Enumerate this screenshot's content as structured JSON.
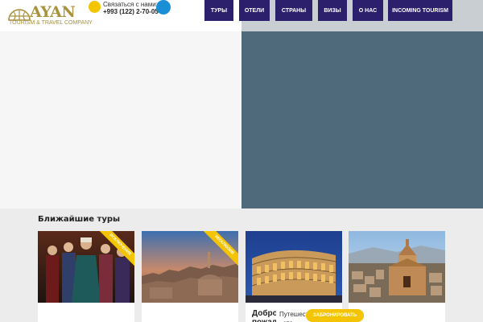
{
  "header": {
    "logo": {
      "word": "AYAN",
      "tagline": "TOURISM & TRAVEL COMPANY"
    },
    "contact": {
      "label": "Связаться с нами:",
      "phone": "+993 (122) 2-70-05"
    },
    "nav": [
      {
        "label": "ТУРЫ"
      },
      {
        "label": "ОТЕЛИ"
      },
      {
        "label": "СТРАНЫ"
      },
      {
        "label": "ВИЗЫ"
      },
      {
        "label": "О НАС"
      },
      {
        "label": "INCOMING TOURISM"
      }
    ],
    "colors": {
      "nav_bg": "#2c1f6b",
      "accent_yellow": "#f5c400",
      "accent_blue": "#1a8fd6",
      "logo_gold": "#a8923e"
    }
  },
  "hero": {
    "left_bg": "#f6f6f6",
    "right_bg": "#4f6a7a"
  },
  "section": {
    "title": "Ближайшие туры",
    "cards": [
      {
        "ribbon": "ИСКЛЮЧЕНИЕ",
        "image": "historical-drama-cast"
      },
      {
        "ribbon": "ЭКСКЛЮЗИВ",
        "image": "old-city-sunset"
      },
      {
        "image": "colosseum-night",
        "title": "Добро пожаловать",
        "desc": "Путешествия - это"
      },
      {
        "image": "church-cityscape"
      }
    ],
    "book_label": "ЗАБРОНИРОВАТЬ"
  }
}
